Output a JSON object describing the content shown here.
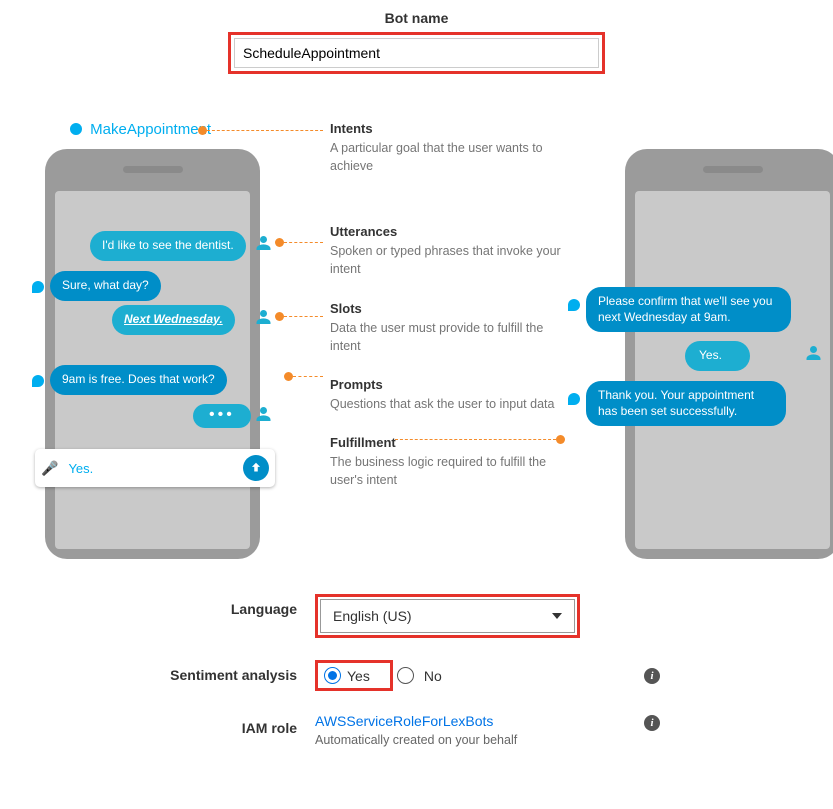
{
  "top": {
    "label": "Bot name",
    "value": "ScheduleAppointment"
  },
  "diagram": {
    "appointment_label": "MakeAppointment",
    "left_phone": {
      "b1": "I'd like to see the dentist.",
      "b2": "Sure, what day?",
      "b3": "Next Wednesday.",
      "b4": "9am is free. Does that work?",
      "input_value": "Yes."
    },
    "right_phone": {
      "b1": "Please confirm that we'll see you next Wednesday at 9am.",
      "b2": "Yes.",
      "b3": "Thank you. Your appointment has been set successfully."
    },
    "defs": {
      "intents_t": "Intents",
      "intents_b": "A particular goal that the user wants to achieve",
      "utter_t": "Utterances",
      "utter_b": "Spoken or typed phrases that invoke your intent",
      "slots_t": "Slots",
      "slots_b": "Data the user must provide to fulfill the intent",
      "prompts_t": "Prompts",
      "prompts_b": "Questions that ask the user to input data",
      "fulfill_t": "Fulfillment",
      "fulfill_b": "The business logic required to fulfill the user's intent"
    }
  },
  "form": {
    "language_label": "Language",
    "language_value": "English (US)",
    "sentiment_label": "Sentiment analysis",
    "sentiment_yes": "Yes",
    "sentiment_no": "No",
    "iam_label": "IAM role",
    "iam_value": "AWSServiceRoleForLexBots",
    "iam_helper": "Automatically created on your behalf"
  }
}
